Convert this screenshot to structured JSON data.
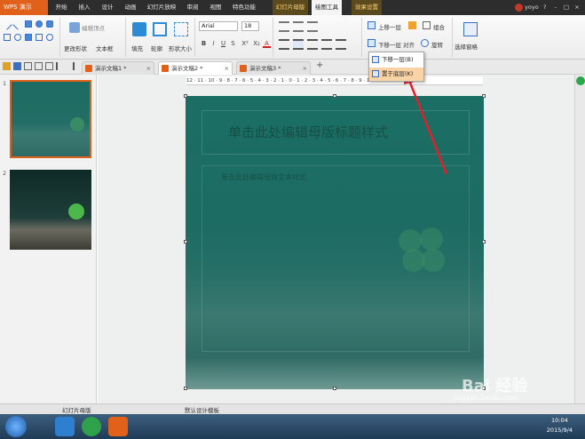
{
  "menubar": {
    "app_name": "WPS 演示",
    "tabs": [
      "开始",
      "插入",
      "设计",
      "动画",
      "幻灯片放映",
      "审阅",
      "视图",
      "特色功能",
      "幻灯片母版",
      "绘图工具",
      "效果设置"
    ],
    "active_tab": "绘图工具",
    "user": "yoyo",
    "window_controls": [
      "?",
      "-",
      "□",
      "×"
    ]
  },
  "ribbon": {
    "edit_vertex": "编辑顶点",
    "change_shape": "更改形状",
    "textbox": "文本框",
    "fill": "填充",
    "outline": "轮廓",
    "shape_size": "形状大小",
    "font_name": "Arial",
    "font_size": "18",
    "bring_forward": "上移一层",
    "send_backward": "下移一层",
    "group": "组合",
    "align": "对齐",
    "rotate": "旋转",
    "selection_pane": "选择窗格",
    "format_buttons": [
      "B",
      "I",
      "U",
      "S",
      "X²",
      "X₂",
      "A"
    ]
  },
  "dropdown": {
    "items": [
      "下移一层(B)",
      "置于底层(K)"
    ],
    "highlighted": "置于底层(K)"
  },
  "doc_tabs": [
    "演示文稿1 *",
    "演示文稿2 *",
    "演示文稿3 *"
  ],
  "active_doc_tab": "演示文稿2 *",
  "thumbnails": {
    "numbers": [
      "1",
      "2"
    ]
  },
  "ruler": "12 · 11 · 10 · 9 · 8 · 7 · 6 · 5 · 4 · 3 · 2 · 1 · 0 · 1 · 2 · 3 · 4 · 5 · 6 · 7 · 8 · 9 · 10 · 11 · 12",
  "slide": {
    "title_placeholder": "单击此处编辑母版标题样式",
    "body_placeholder": "单击此处编辑母版文本样式"
  },
  "status": {
    "left": "幻灯片母版",
    "middle": "默认设计模板"
  },
  "watermark": {
    "brand": "Bai 经验",
    "url": "jingyan.baidu.com"
  },
  "clock": {
    "time": "10:04",
    "date": "2015/9/4"
  },
  "colors": {
    "accent": "#e1601a",
    "slide_bg": "#1d6c63",
    "arrow": "#e0202a"
  }
}
